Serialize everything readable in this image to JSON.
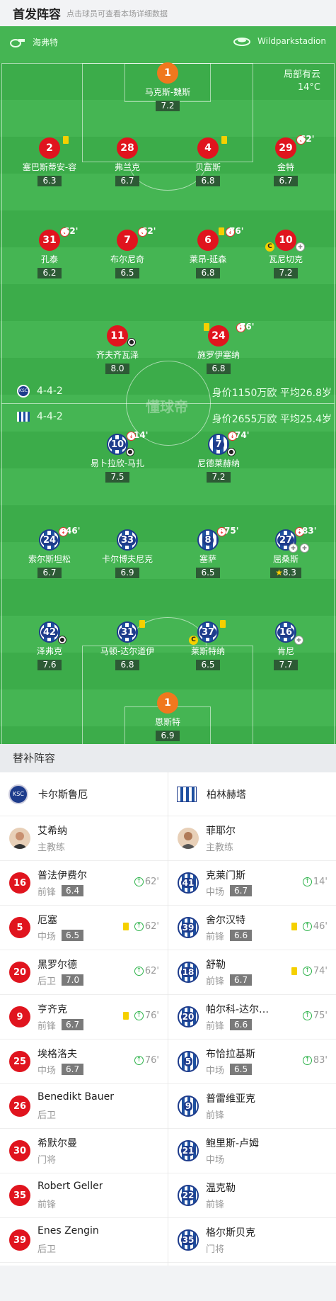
{
  "header": {
    "title": "首发阵容",
    "subtitle": "点击球员可查看本场详细数据"
  },
  "pitch": {
    "home_team": "海弗特",
    "stadium": "Wildparkstadion",
    "weather": "局部有云",
    "temperature": "14°C",
    "watermark": "懂球帝",
    "home_formation": "4-4-2",
    "home_value": "身价1150万欧 平均26.8岁",
    "away_formation": "4-4-2",
    "away_value": "身价2655万欧 平均25.4岁"
  },
  "home_players": [
    {
      "num": "1",
      "name": "马克斯-魏斯",
      "rating": "7.2"
    },
    {
      "num": "2",
      "name": "塞巴斯蒂安-容",
      "rating": "6.3"
    },
    {
      "num": "28",
      "name": "弗兰克",
      "rating": "6.7"
    },
    {
      "num": "4",
      "name": "贝富斯",
      "rating": "6.8"
    },
    {
      "num": "29",
      "name": "金特",
      "rating": "6.7",
      "sub": "62'"
    },
    {
      "num": "31",
      "name": "孔泰",
      "rating": "6.2",
      "sub": "62'"
    },
    {
      "num": "7",
      "name": "布尔尼奇",
      "rating": "6.5",
      "sub": "62'"
    },
    {
      "num": "6",
      "name": "莱昂-延森",
      "rating": "6.8",
      "sub": "76'"
    },
    {
      "num": "10",
      "name": "瓦尼切克",
      "rating": "7.2"
    },
    {
      "num": "11",
      "name": "齐夫齐瓦泽",
      "rating": "8.0"
    },
    {
      "num": "24",
      "name": "施罗伊塞纳",
      "rating": "6.8",
      "sub": "76'"
    }
  ],
  "away_players": [
    {
      "num": "10",
      "name": "易卜拉欣-马扎",
      "rating": "7.5",
      "sub": "14'"
    },
    {
      "num": "7",
      "name": "尼德莱赫纳",
      "rating": "7.2",
      "sub": "74'"
    },
    {
      "num": "24",
      "name": "索尔斯坦松",
      "rating": "6.7",
      "sub": "46'"
    },
    {
      "num": "33",
      "name": "卡尔博夫尼克",
      "rating": "6.9"
    },
    {
      "num": "8",
      "name": "塞萨",
      "rating": "6.5",
      "sub": "75'"
    },
    {
      "num": "27",
      "name": "屈桑斯",
      "rating": "8.3",
      "sub": "83'"
    },
    {
      "num": "42",
      "name": "泽弗克",
      "rating": "7.6"
    },
    {
      "num": "31",
      "name": "马顿-达尔道伊",
      "rating": "6.8"
    },
    {
      "num": "37",
      "name": "莱斯特纳",
      "rating": "6.5"
    },
    {
      "num": "16",
      "name": "肯尼",
      "rating": "7.7"
    },
    {
      "num": "1",
      "name": "恩斯特",
      "rating": "6.9"
    }
  ],
  "subs": {
    "title": "替补阵容",
    "home_team": "卡尔斯鲁厄",
    "away_team": "柏林赫塔",
    "home_coach": {
      "name": "艾希纳",
      "role": "主教练"
    },
    "away_coach": {
      "name": "菲耶尔",
      "role": "主教练"
    },
    "home": [
      {
        "num": "16",
        "name": "普法伊费尔",
        "pos": "前锋",
        "rating": "6.4",
        "time": "62'"
      },
      {
        "num": "5",
        "name": "厄塞",
        "pos": "中场",
        "rating": "6.5",
        "time": "62'"
      },
      {
        "num": "20",
        "name": "黑罗尔德",
        "pos": "后卫",
        "rating": "7.0",
        "time": "62'"
      },
      {
        "num": "9",
        "name": "亨齐克",
        "pos": "前锋",
        "rating": "6.7",
        "time": "76'"
      },
      {
        "num": "25",
        "name": "埃格洛夫",
        "pos": "中场",
        "rating": "6.7",
        "time": "76'"
      },
      {
        "num": "26",
        "name": "Benedikt Bauer",
        "pos": "后卫"
      },
      {
        "num": "30",
        "name": "希默尔曼",
        "pos": "门将"
      },
      {
        "num": "35",
        "name": "Robert Geller",
        "pos": "前锋"
      },
      {
        "num": "39",
        "name": "Enes Zengin",
        "pos": "后卫"
      }
    ],
    "away": [
      {
        "num": "41",
        "name": "克莱门斯",
        "pos": "中场",
        "rating": "6.7",
        "time": "14'"
      },
      {
        "num": "39",
        "name": "舍尔汉特",
        "pos": "前锋",
        "rating": "6.6",
        "time": "46'"
      },
      {
        "num": "18",
        "name": "舒勒",
        "pos": "前锋",
        "rating": "6.7",
        "time": "74'"
      },
      {
        "num": "20",
        "name": "帕尔科-达尔…",
        "pos": "前锋",
        "rating": "6.6",
        "time": "75'"
      },
      {
        "num": "5",
        "name": "布恰拉基斯",
        "pos": "中场",
        "rating": "6.5",
        "time": "83'"
      },
      {
        "num": "9",
        "name": "普雷维亚克",
        "pos": "前锋"
      },
      {
        "num": "21",
        "name": "鲍里斯-卢姆",
        "pos": "中场"
      },
      {
        "num": "22",
        "name": "温克勒",
        "pos": "前锋"
      },
      {
        "num": "35",
        "name": "格尔斯贝克",
        "pos": "门将"
      }
    ]
  }
}
